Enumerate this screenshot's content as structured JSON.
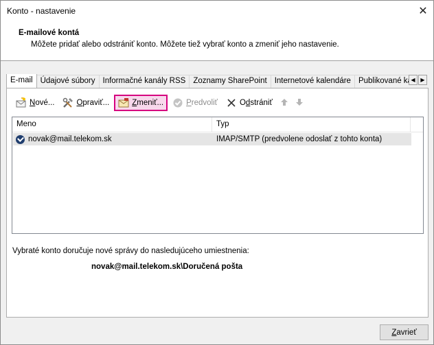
{
  "window": {
    "title": "Konto - nastavenie"
  },
  "header": {
    "title": "E-mailové kontá",
    "description": "Môžete pridať alebo odstrániť konto. Môžete tiež vybrať konto a zmeniť jeho nastavenie."
  },
  "tabs": [
    {
      "label": "E-mail",
      "active": true
    },
    {
      "label": "Údajové súbory"
    },
    {
      "label": "Informačné kanály RSS"
    },
    {
      "label": "Zoznamy SharePoint"
    },
    {
      "label": "Internetové kalendáre"
    },
    {
      "label": "Publikované kalendáre"
    }
  ],
  "toolbar": {
    "new_label_mn": "N",
    "new_label_rest": "ové...",
    "repair_label_mn": "O",
    "repair_label_rest": "praviť...",
    "change_label_mn": "Z",
    "change_label_rest": "meniť...",
    "default_label_mn": "P",
    "default_label_rest": "redvoliť",
    "remove_label_pre": "O",
    "remove_label_mn": "d",
    "remove_label_rest": "strániť"
  },
  "list": {
    "columns": [
      "Meno",
      "Typ"
    ],
    "rows": [
      {
        "name": "novak@mail.telekom.sk",
        "type": "IMAP/SMTP (predvolene odoslať z tohto konta)"
      }
    ]
  },
  "delivery": {
    "text": "Vybraté konto doručuje nové správy do nasledujúceho umiestnenia:",
    "path": "novak@mail.telekom.sk\\Doručená pošta"
  },
  "footer": {
    "close_mn": "Z",
    "close_rest": "avrieť"
  },
  "colors": {
    "highlight_border": "#d6007f",
    "highlight_fill": "#f8d8ec"
  }
}
